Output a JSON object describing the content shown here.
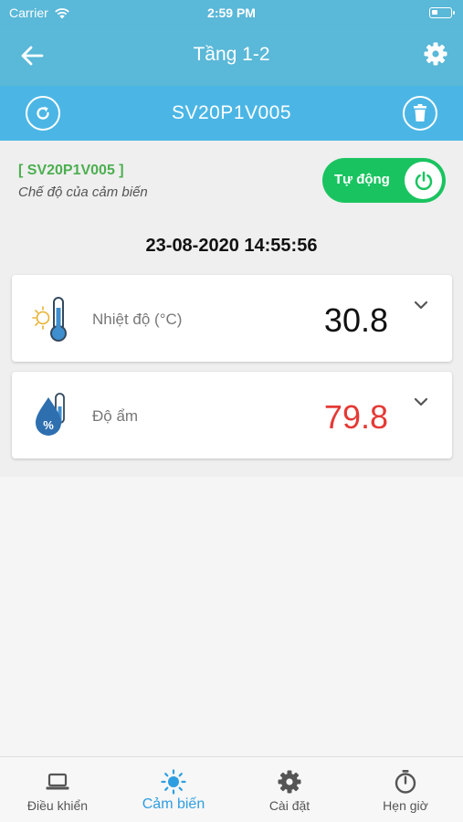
{
  "status_bar": {
    "carrier": "Carrier",
    "time": "2:59 PM"
  },
  "header": {
    "title": "Tầng 1-2"
  },
  "device": {
    "name": "SV20P1V005"
  },
  "sensor": {
    "code": "[ SV20P1V005 ]",
    "mode_caption": "Chế độ của cảm biến",
    "mode_label": "Tự động"
  },
  "timestamp": "23-08-2020 14:55:56",
  "readings": [
    {
      "label": "Nhiệt độ (°C)",
      "value": "30.8",
      "icon": "thermometer-sun-icon"
    },
    {
      "label": "Độ ẩm",
      "value": "79.8",
      "icon": "humidity-drop-icon"
    }
  ],
  "tabs": [
    {
      "label": "Điều khiển",
      "icon": "laptop-icon",
      "active": false
    },
    {
      "label": "Cảm biến",
      "icon": "sun-icon",
      "active": true
    },
    {
      "label": "Cài đặt",
      "icon": "gear-icon",
      "active": false
    },
    {
      "label": "Hẹn giờ",
      "icon": "stopwatch-icon",
      "active": false
    }
  ],
  "colors": {
    "header": "#5ab8d8",
    "device_bar": "#4bb6e5",
    "toggle": "#19c460",
    "accent": "#2f9ee0",
    "alert": "#e53935",
    "sensor_code": "#4caf50"
  }
}
